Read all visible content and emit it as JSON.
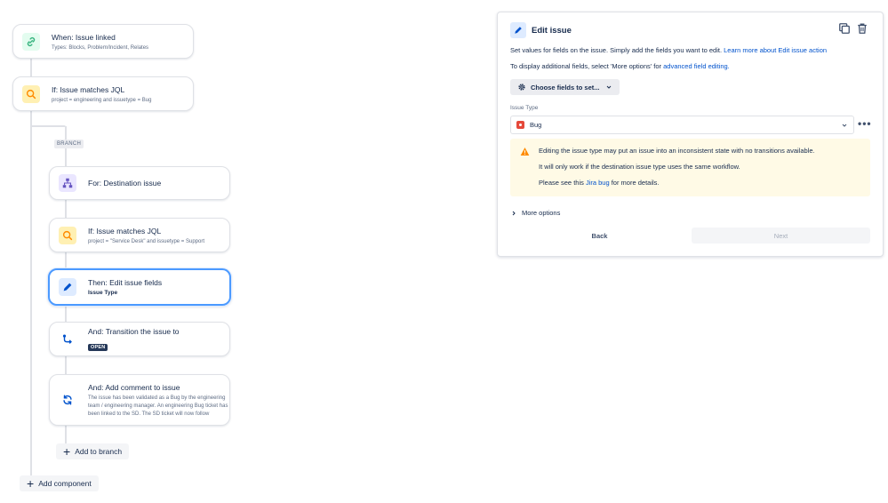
{
  "flow": {
    "trigger": {
      "title": "When: Issue linked",
      "subtitle": "Types: Blocks, Problem/Incident, Relates",
      "icon": "link-icon"
    },
    "condition": {
      "title": "If: Issue matches JQL",
      "subtitle": "project = engineering and issuetype = Bug",
      "icon": "search-icon"
    },
    "branch_label": "BRANCH",
    "branch": {
      "for": {
        "title": "For: Destination issue",
        "icon": "hierarchy-icon"
      },
      "jql": {
        "title": "If: Issue matches JQL",
        "subtitle": "project = \"Service Desk\" and issuetype = Support",
        "icon": "search-icon"
      },
      "edit": {
        "title": "Then: Edit issue fields",
        "subtitle": "Issue Type",
        "icon": "pencil-icon"
      },
      "transition": {
        "title": "And: Transition the issue to",
        "status": "OPEN",
        "icon": "transition-icon"
      },
      "comment": {
        "title": "And: Add comment to issue",
        "body": "The issue has been validated as a Bug by the engineering team / engineering manager. An engineering Bug ticket has been linked to the SD. The SD ticket will now follow",
        "icon": "refresh-icon"
      }
    },
    "add_to_branch": "Add to branch",
    "add_component": "Add component"
  },
  "panel": {
    "title": "Edit issue",
    "intro_text": "Set values for fields on the issue. Simply add the fields you want to edit. ",
    "intro_link": "Learn more about Edit issue action",
    "additional_text": "To display additional fields, select 'More options' for ",
    "additional_link": "advanced field editing.",
    "choose_fields": "Choose fields to set...",
    "field_label": "Issue Type",
    "field_value": "Bug",
    "more_dots": "•••",
    "warning": {
      "line1": "Editing the issue type may put an issue into an inconsistent state with no transitions available.",
      "line2": "It will only work if the destination issue type uses the same workflow.",
      "line3_before": "Please see this ",
      "line3_link": "Jira bug",
      "line3_after": " for more details."
    },
    "more_options": "More options",
    "back": "Back",
    "next": "Next"
  },
  "colors": {
    "accent": "#0052cc",
    "selected_border": "#4c9aff",
    "warning_bg": "#fffae6",
    "bug_red": "#e5493a"
  }
}
